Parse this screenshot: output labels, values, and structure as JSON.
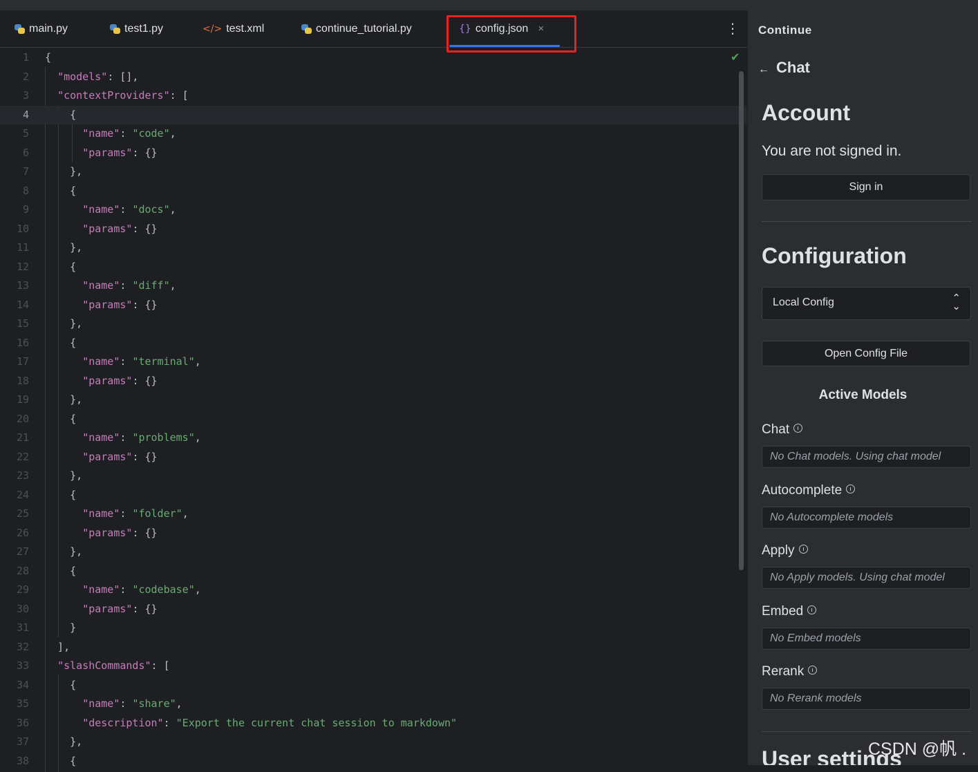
{
  "tabs": [
    {
      "label": "main.py",
      "icon": "python-icon"
    },
    {
      "label": "test1.py",
      "icon": "python-icon"
    },
    {
      "label": "test.xml",
      "icon": "xml-icon"
    },
    {
      "label": "continue_tutorial.py",
      "icon": "python-icon"
    },
    {
      "label": "config.json",
      "icon": "json-icon",
      "active": true
    }
  ],
  "tab_icons": {
    "xml": "</>",
    "json": "{}",
    "close": "×",
    "more": "⋮",
    "check": "✔"
  },
  "code_lines": [
    "{",
    "  \"models\": [],",
    "  \"contextProviders\": [",
    "    {",
    "      \"name\": \"code\",",
    "      \"params\": {}",
    "    },",
    "    {",
    "      \"name\": \"docs\",",
    "      \"params\": {}",
    "    },",
    "    {",
    "      \"name\": \"diff\",",
    "      \"params\": {}",
    "    },",
    "    {",
    "      \"name\": \"terminal\",",
    "      \"params\": {}",
    "    },",
    "    {",
    "      \"name\": \"problems\",",
    "      \"params\": {}",
    "    },",
    "    {",
    "      \"name\": \"folder\",",
    "      \"params\": {}",
    "    },",
    "    {",
    "      \"name\": \"codebase\",",
    "      \"params\": {}",
    "    }",
    "  ],",
    "  \"slashCommands\": [",
    "    {",
    "      \"name\": \"share\",",
    "      \"description\": \"Export the current chat session to markdown\"",
    "    },",
    "    {"
  ],
  "current_line": 4,
  "panel": {
    "title": "Continue",
    "back_label": "Chat",
    "account_heading": "Account",
    "signed_out_text": "You are not signed in.",
    "sign_in_label": "Sign in",
    "config_heading": "Configuration",
    "config_select_value": "Local Config",
    "open_config_label": "Open Config File",
    "active_models_heading": "Active Models",
    "models": [
      {
        "label": "Chat",
        "value": "No Chat models. Using chat model"
      },
      {
        "label": "Autocomplete",
        "value": "No Autocomplete models"
      },
      {
        "label": "Apply",
        "value": "No Apply models. Using chat model"
      },
      {
        "label": "Embed",
        "value": "No Embed models"
      },
      {
        "label": "Rerank",
        "value": "No Rerank models"
      }
    ],
    "user_settings_heading": "User settings"
  },
  "watermark": "CSDN @帆 .",
  "colors": {
    "accent": "#3574f0",
    "highlight_box": "#e8231f",
    "string": "#6aab73",
    "key": "#c77dbb"
  }
}
